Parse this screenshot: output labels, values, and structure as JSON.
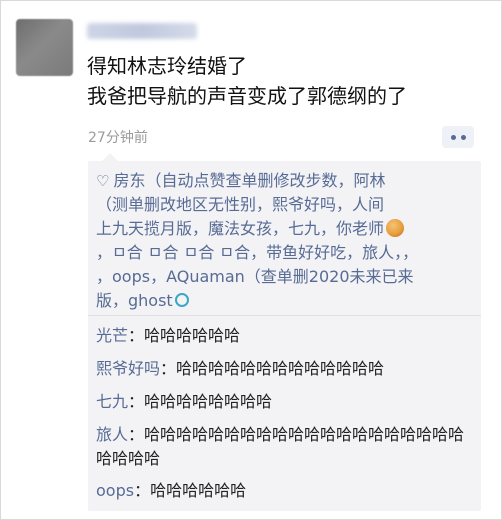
{
  "post": {
    "line1": "得知林志玲结婚了",
    "line2": "我爸把导航的声音变成了郭德纲的了",
    "timestamp": "27分钟前"
  },
  "likes": {
    "lines": [
      "房东（自动点赞查单删修改步数，阿林",
      "（测单删改地区无性别，熙爷好吗，人间",
      "上九天揽月版，魔法女孩，七九，你老师",
      "，ㅁ合 ㅁ合 ㅁ合 ㅁ合，带鱼好好吃，旅人，，",
      "，oops，AQuaman（查单删2020未来已来",
      "版，ghost"
    ]
  },
  "comments": [
    {
      "author": "光芒",
      "text": "哈哈哈哈哈哈"
    },
    {
      "author": "熙爷好吗",
      "text": "哈哈哈哈哈哈哈哈哈哈哈哈哈"
    },
    {
      "author": "七九",
      "text": "哈哈哈哈哈哈哈哈"
    },
    {
      "author": "旅人",
      "text": "哈哈哈哈哈哈哈哈哈哈哈哈哈哈哈哈哈哈哈哈哈哈哈哈"
    },
    {
      "author": "oops",
      "text": "哈哈哈哈哈哈"
    }
  ],
  "colors": {
    "link_blue": "#576b95",
    "comment_bg": "#f3f3f5",
    "timestamp_gray": "#9b9b9b"
  },
  "icons": [
    "avatar",
    "heart-icon",
    "more-dots-icon",
    "emoji-icon",
    "circle-icon"
  ]
}
